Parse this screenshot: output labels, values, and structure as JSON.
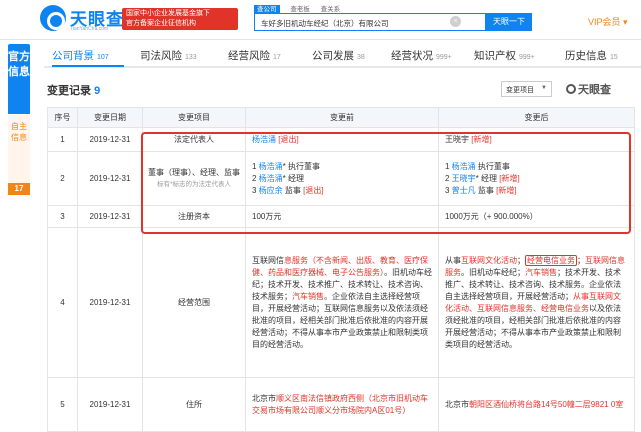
{
  "header": {
    "logo_text": "天眼查",
    "logo_sub": "TianYanCha.com",
    "gov_badge": [
      "国家中小企业发展基金旗下",
      "官方备案企业征信机构"
    ],
    "search_tabs": [
      "查公司",
      "查老板",
      "查关系"
    ],
    "search_value": "车好多旧机动车经纪（北京）有限公司",
    "search_button": "天眼一下",
    "vip": "VIP会员 ▾"
  },
  "sidebar": {
    "active": "官方信息",
    "inactive": "自主信息",
    "badge": "17"
  },
  "nav": [
    {
      "label": "公司背景",
      "count": "107"
    },
    {
      "label": "司法风险",
      "count": "133"
    },
    {
      "label": "经营风险",
      "count": "17"
    },
    {
      "label": "公司发展",
      "count": "38"
    },
    {
      "label": "经营状况",
      "count": "999+"
    },
    {
      "label": "知识产权",
      "count": "999+"
    },
    {
      "label": "历史信息",
      "count": "15"
    }
  ],
  "section": {
    "title": "变更记录",
    "count": "9",
    "select": "变更项目",
    "watermark": "天眼查"
  },
  "table": {
    "headers": [
      "序号",
      "变更日期",
      "变更项目",
      "变更前",
      "变更后"
    ],
    "rows": [
      {
        "idx": "1",
        "date": "2019-12-31",
        "item": "法定代表人",
        "before": {
          "name": "杨浩涌",
          "tag": "[退出]"
        },
        "after": {
          "name": "王晓宇",
          "tag": "[新增]"
        }
      },
      {
        "idx": "2",
        "date": "2019-12-31",
        "item": "董事（理事）、经理、监事",
        "note": "标有*标志的为法定代表人",
        "before": [
          "1 ",
          "杨浩涌",
          "* 执行董事",
          "2 ",
          "杨浩涌",
          "* 经理",
          "3 ",
          "杨应余",
          " 监事 ",
          "[退出]"
        ],
        "after": [
          "1 ",
          "杨浩涌",
          " 执行董事",
          "2 ",
          "王晓宇",
          "* 经理 ",
          "[新增]",
          "3 ",
          "曾士凡",
          " 监事 ",
          "[新增]"
        ]
      },
      {
        "idx": "3",
        "date": "2019-12-31",
        "item": "注册资本",
        "before": "100万元",
        "after": "1000万元（+ 900.000%）"
      },
      {
        "idx": "4",
        "date": "2019-12-31",
        "item": "经营范围",
        "before": [
          "互联网信",
          "息服务",
          "（不含新闻、出版、教育、医疗保健、药品和医疗器械、电子公告服务）",
          "。旧机动车经纪；技术开发、技术推广、技术转让、技术咨询、技术服务；",
          "汽车销售",
          "。企业依法自主选择经营项目，开展经营活动；互联网信息服务以及依法须经批准的项目，经相关部门批准后依批准的内容开展经营活动；不得从事本市产业政策禁止和限制类项目的经营活动。"
        ],
        "after": [
          "从事",
          "互联网文化活动",
          "；",
          "经营电信业务",
          "；",
          "互联网信息服务",
          "。旧机动车经纪；",
          "汽车销售",
          "；技术开发、技术推广、技术转让、技术咨询、技术服务。企业依法自主选择经营项目，开展经营活动；",
          "从事互联网文化活动、互联网信息服务、经营电信业务",
          "以及依法须经批准的项目，经相关部门批准后依批准的内容开展经营活动；不得从事本市产业政策禁止和限制类项目的经营活动。"
        ]
      },
      {
        "idx": "5",
        "date": "2019-12-31",
        "item": "住所",
        "before": [
          "北京市",
          "顺义区",
          "南法信镇政府西侧",
          "（北京市旧机动车交易市场有限公司顺义分市场院内A区01号）"
        ],
        "after": [
          "北京市",
          "朝阳区",
          "酒仙桥将台路14号50幢二层9821 0室"
        ]
      }
    ]
  },
  "colors": {
    "brand": "#0f84f0",
    "alert": "#e0332a",
    "vip": "#f08519"
  }
}
